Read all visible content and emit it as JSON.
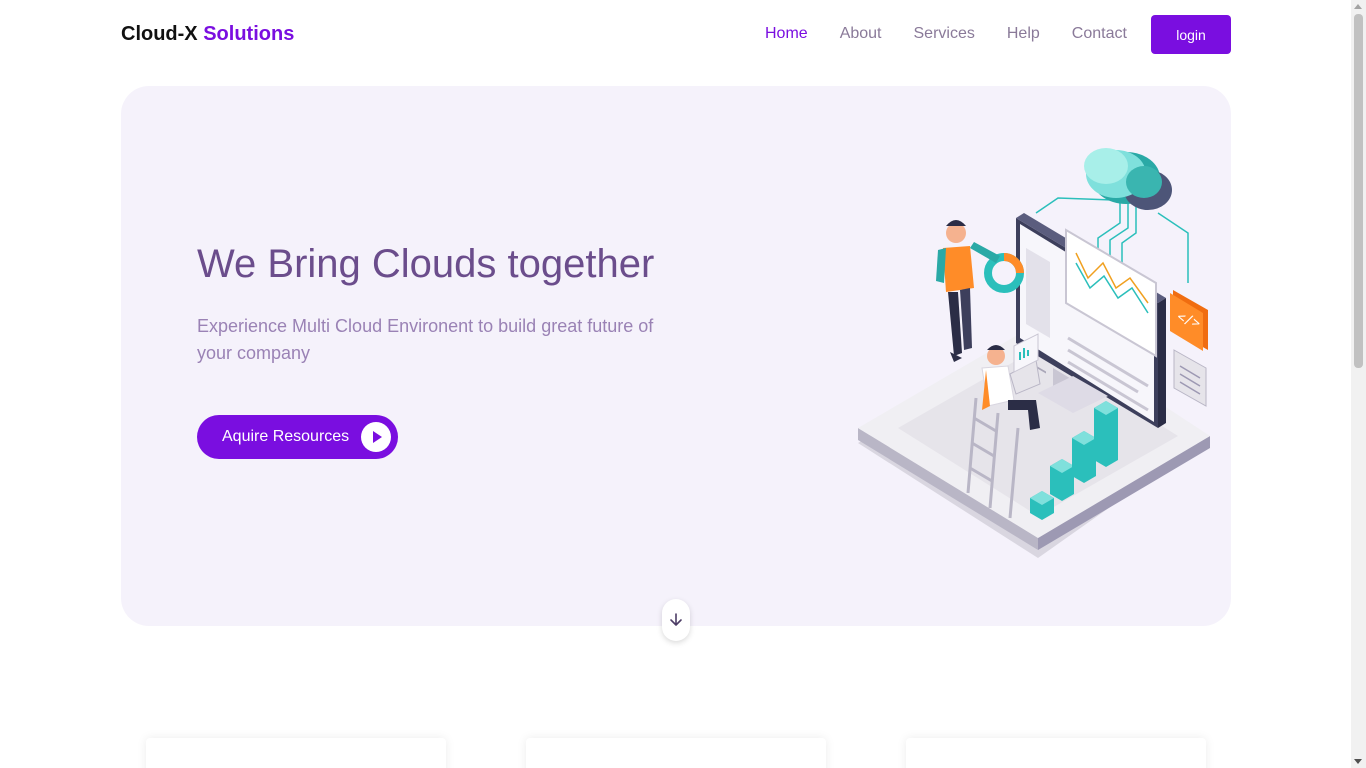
{
  "brand": {
    "name_part1": "Cloud-X",
    "name_part2": "Solutions"
  },
  "nav": {
    "items": [
      {
        "label": "Home",
        "active": true
      },
      {
        "label": "About",
        "active": false
      },
      {
        "label": "Services",
        "active": false
      },
      {
        "label": "Help",
        "active": false
      },
      {
        "label": "Contact",
        "active": false
      }
    ],
    "login_label": "login"
  },
  "hero": {
    "title": "We Bring Clouds together",
    "subtitle": "Experience Multi Cloud Environent to build great future of your company",
    "cta_label": "Aquire Resources",
    "cta_icon": "play-icon",
    "illustration": "cloud-computing-illustration",
    "scroll_icon": "arrow-down-icon"
  },
  "colors": {
    "accent": "#7a0ee0",
    "hero_bg": "#f5f2fb",
    "title": "#6b4d8c",
    "subtitle": "#9a82b5",
    "nav_text": "#8a7a99"
  }
}
